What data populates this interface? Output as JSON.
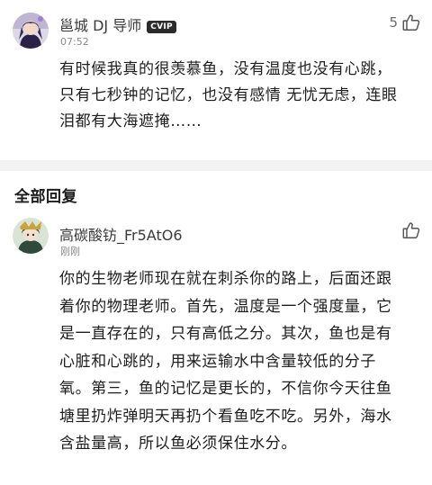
{
  "main_comment": {
    "author": "邕城 DJ 导师",
    "badge": "CVIP",
    "time": "07:52",
    "likes": "5",
    "lines": [
      "有时候我真的很羡慕鱼，没有温度也没有心跳，",
      "只有七秒钟的记忆，也没有感情 无忧无虑，连眼",
      "泪都有大海遮掩……"
    ]
  },
  "section": {
    "title": "全部回复"
  },
  "reply": {
    "author": "高碳酸钫_Fr5AtO6",
    "time": "刚刚",
    "lines": [
      "你的生物老师现在就在刺杀你的路上，后面还跟",
      "着你的物理老师。首先，温度是一个强度量，它",
      "是一直存在的，只有高低之分。其次，鱼也是有",
      "心脏和心跳的，用来运输水中含量较低的分子",
      "氧。第三，鱼的记忆是更长的，不信你今天往鱼",
      "塘里扔炸弹明天再扔个看鱼吃不吃。另外，海水",
      "含盐量高，所以鱼必须保住水分。"
    ]
  },
  "icons": {
    "like": "thumbs-up-icon",
    "avatar_main": "avatar",
    "avatar_reply": "avatar"
  },
  "colors": {
    "divider": "#f2f2f2",
    "badge_bg": "#2b2b2b",
    "meta_text": "#8a8a8a"
  }
}
